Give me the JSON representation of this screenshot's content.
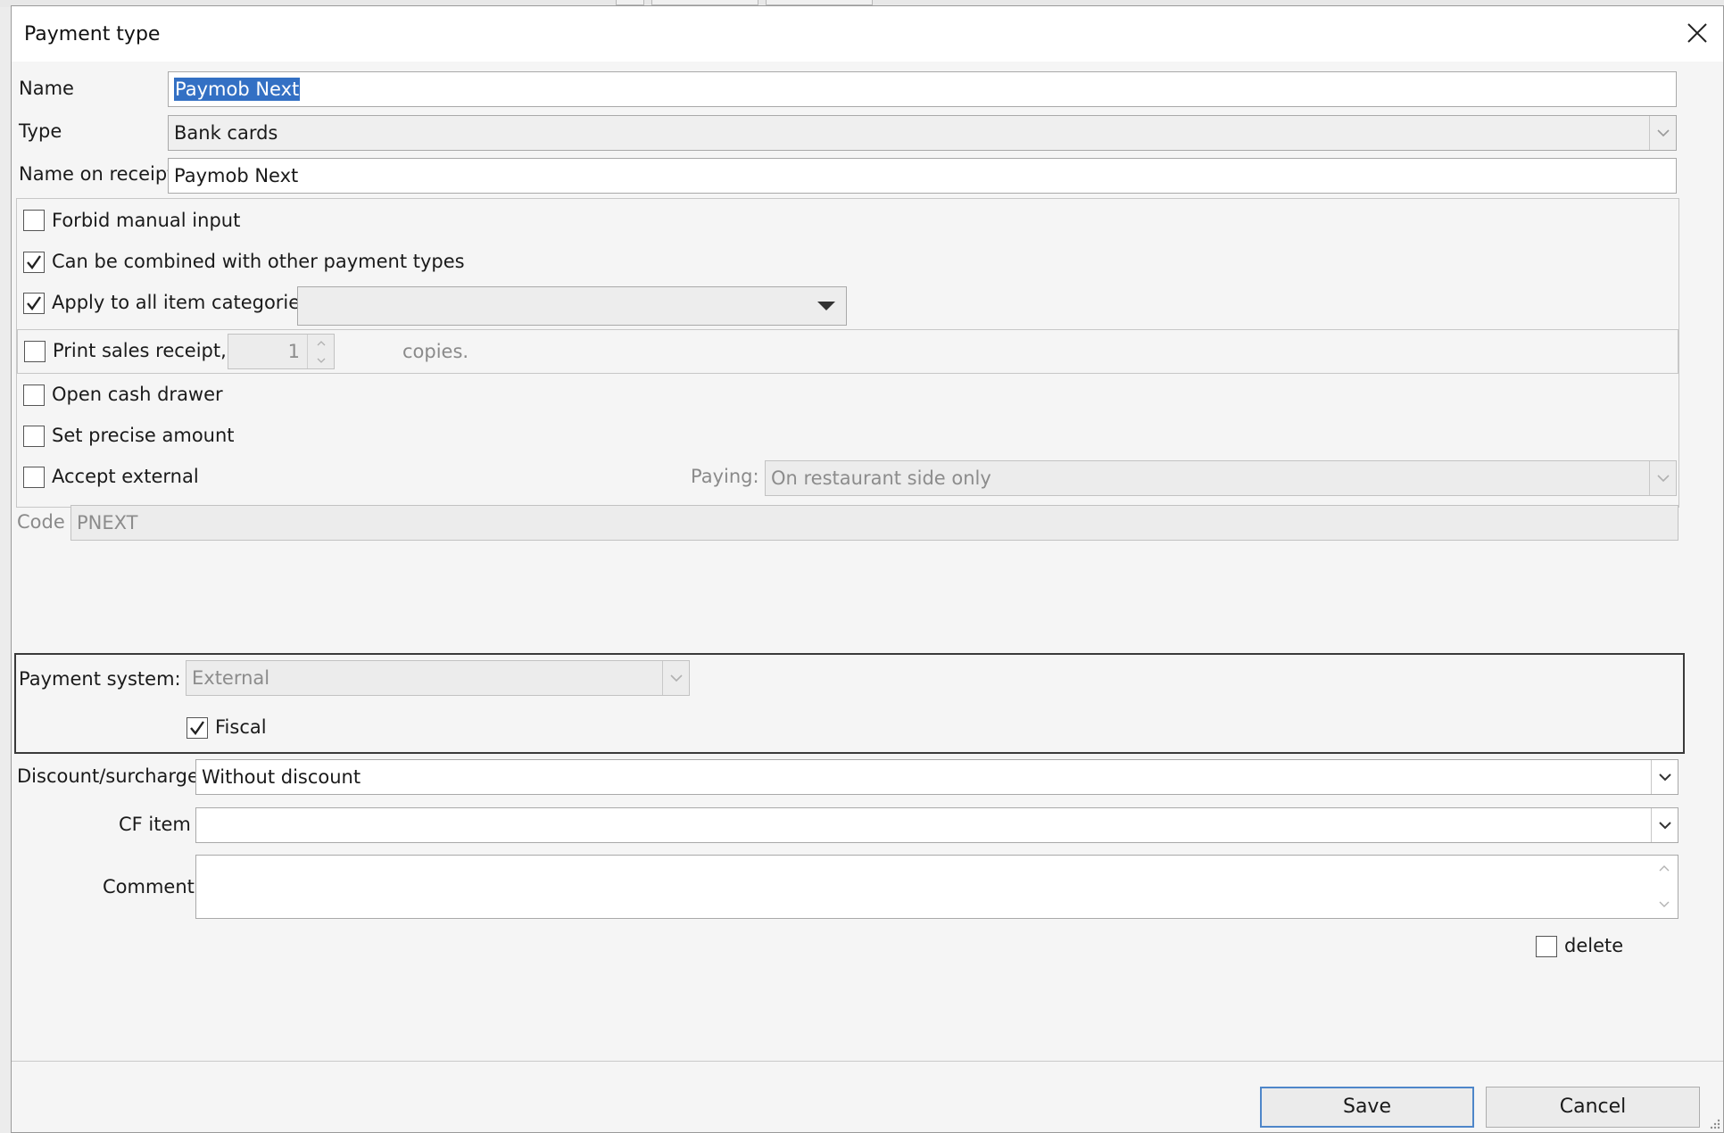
{
  "window": {
    "title": "Payment type"
  },
  "name": {
    "label": "Name",
    "value": "Paymob Next"
  },
  "type": {
    "label": "Type",
    "value": "Bank cards"
  },
  "receipt_name": {
    "label": "Name on receipt",
    "value": "Paymob Next"
  },
  "options": {
    "forbid_manual": {
      "label": "Forbid manual input",
      "checked": false
    },
    "combinable": {
      "label": "Can be combined with other payment types",
      "checked": true
    },
    "all_categories": {
      "label": "Apply to all item categories",
      "checked": true,
      "dropdown_value": ""
    },
    "print_receipt": {
      "label": "Print sales receipt,",
      "checked": false,
      "copies": "1",
      "copies_suffix": "copies."
    },
    "open_drawer": {
      "label": "Open cash drawer",
      "checked": false
    },
    "precise_amount": {
      "label": "Set precise amount",
      "checked": false
    },
    "accept_external": {
      "label": "Accept external",
      "checked": false
    },
    "paying": {
      "label": "Paying:",
      "value": "On restaurant side only"
    }
  },
  "code": {
    "label": "Code",
    "value": "PNEXT"
  },
  "payment_system": {
    "label": "Payment system:",
    "value": "External",
    "fiscal_label": "Fiscal",
    "fiscal_checked": true
  },
  "discount": {
    "label": "Discount/surcharge",
    "value": "Without discount"
  },
  "cf_item": {
    "label": "CF item",
    "value": ""
  },
  "comment": {
    "label": "Comment",
    "value": ""
  },
  "delete": {
    "label": "delete",
    "checked": false
  },
  "buttons": {
    "save": "Save",
    "cancel": "Cancel"
  }
}
